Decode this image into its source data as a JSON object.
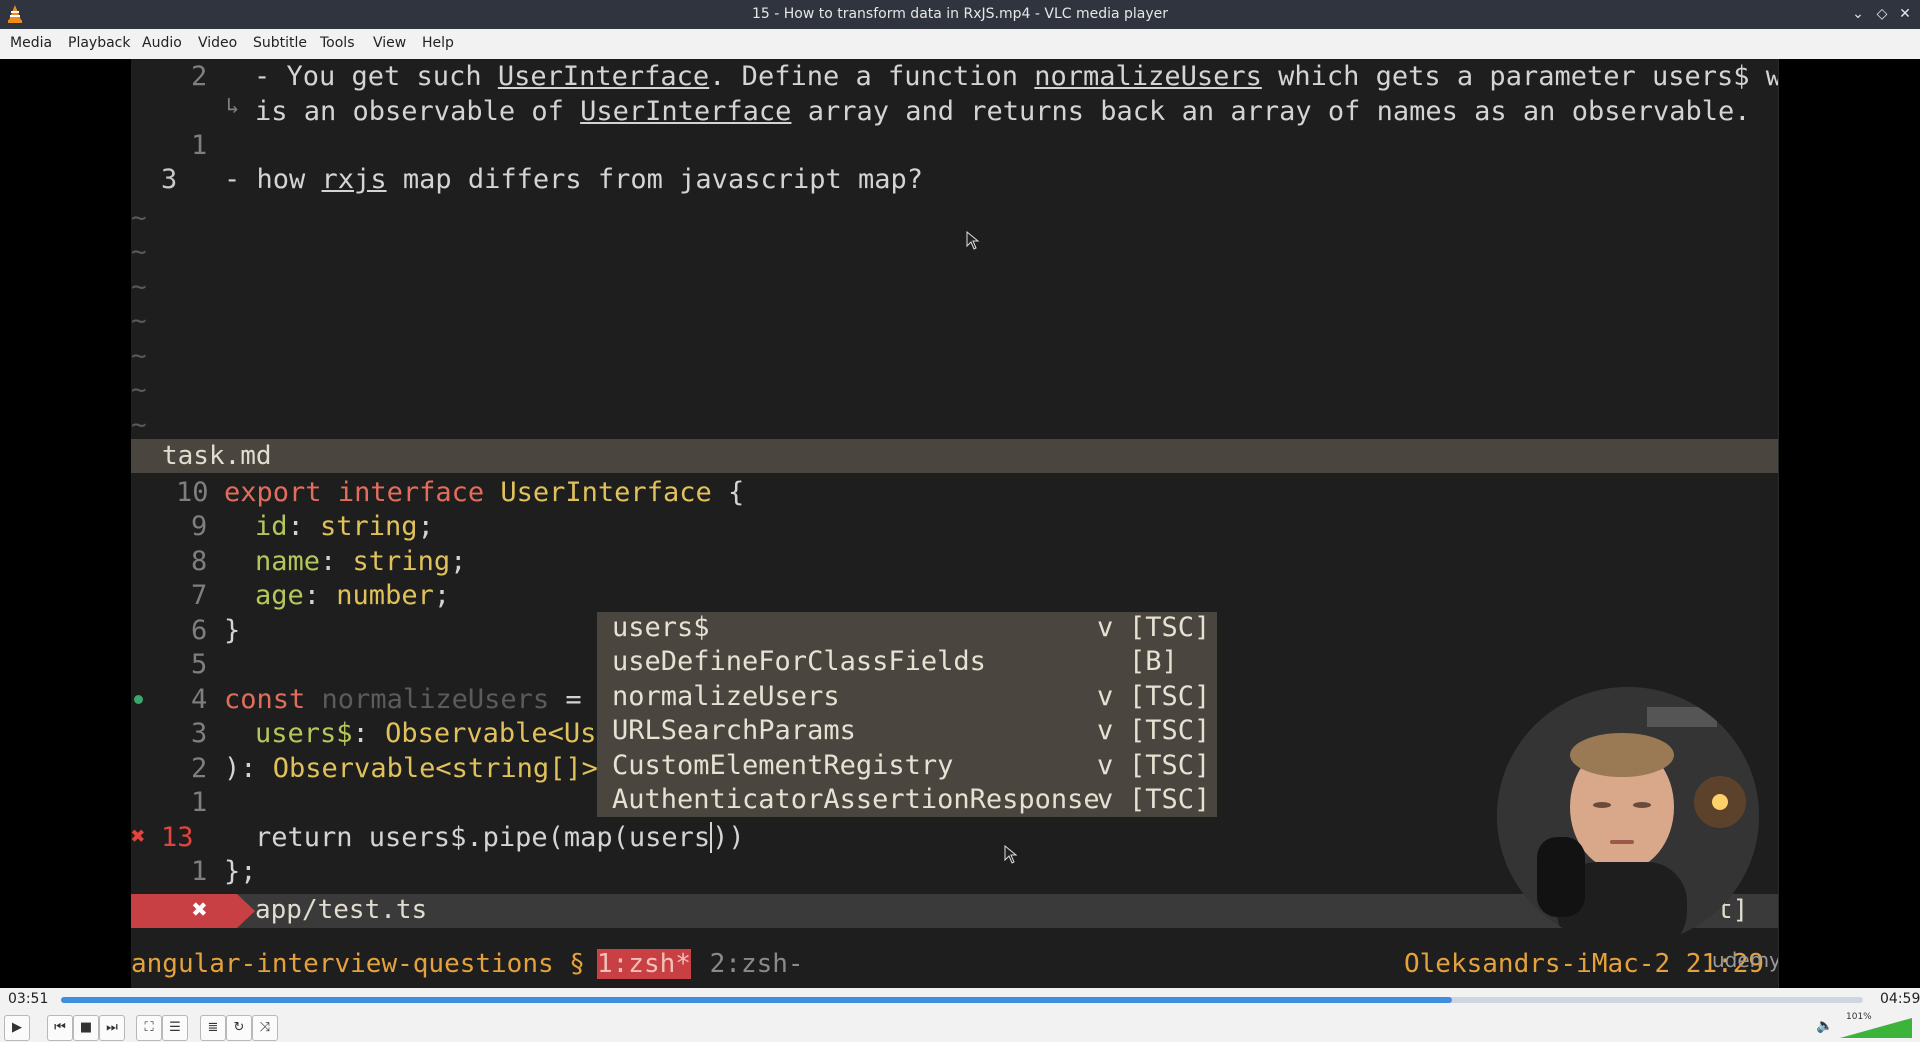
{
  "window": {
    "title": "15 - How to transform data in RxJS.mp4 - VLC media player"
  },
  "menu": [
    "Media",
    "Playback",
    "Audio",
    "Video",
    "Subtitle",
    "Tools",
    "View",
    "Help"
  ],
  "editor_top": {
    "lines": [
      {
        "num": "2",
        "a": "- You get such ",
        "u1": "UserInterface",
        "b": ". Define a function ",
        "u2": "normalizeUsers",
        "c": " which gets a parameter users$ which"
      },
      {
        "wrap_a": "is an observable of ",
        "wrap_u": "UserInterface",
        "wrap_b": " array and returns back an array of names as an observable."
      },
      {
        "num": "1"
      },
      {
        "num": "3",
        "a": "- how ",
        "u1": "rxjs",
        "b": " map differs from javascript map?"
      }
    ],
    "tilde": "~",
    "filename": "task.md"
  },
  "editor_bottom": {
    "line10": {
      "num": "10",
      "k1": "export",
      "k2": "interface",
      "name": "UserInterface",
      "rest": " {"
    },
    "line9": {
      "num": "9",
      "field": "id",
      "type": "string"
    },
    "line8": {
      "num": "8",
      "field": "name",
      "type": "string"
    },
    "line7": {
      "num": "7",
      "field": "age",
      "type": "number"
    },
    "line6": {
      "num": "6",
      "text": "}"
    },
    "line5": {
      "num": "5"
    },
    "line4": {
      "num": "4",
      "k": "const",
      "name": "normalizeUsers",
      "rest": " = ("
    },
    "line3": {
      "num": "3",
      "param": "users$",
      "type": "Observable<Use"
    },
    "line2": {
      "num": "2",
      "a": "): ",
      "type": "Observable<string[]>"
    },
    "line1": {
      "num": "1"
    },
    "line13": {
      "num": "13",
      "text": "return users$.pipe(map(users",
      "text2": "))"
    },
    "line1b": {
      "num": "1",
      "text": "};"
    },
    "error_mark": "✖"
  },
  "completion": [
    {
      "name": "users$",
      "kind": "v",
      "source": "[TSC]"
    },
    {
      "name": "useDefineForClassFields",
      "kind": "",
      "source": "[B]"
    },
    {
      "name": "normalizeUsers",
      "kind": "v",
      "source": "[TSC]"
    },
    {
      "name": "URLSearchParams",
      "kind": "v",
      "source": "[TSC]"
    },
    {
      "name": "CustomElementRegistry",
      "kind": "v",
      "source": "[TSC]"
    },
    {
      "name": "AuthenticatorAssertionResponse",
      "kind": "v",
      "source": "[TSC]"
    }
  ],
  "statusline": {
    "error": "✖",
    "file": "app/test.ts",
    "end": "t]"
  },
  "tmux": {
    "session": "angular-interview-questions § ",
    "win1": "1:zsh*",
    "win2": " 2:zsh-",
    "host": "Oleksandrs-iMac-2 21:29",
    "watermark": "udemy"
  },
  "player": {
    "elapsed": "03:51",
    "total": "04:59",
    "progress": 0.772,
    "volume_label": "101%",
    "volume": 1.01
  }
}
